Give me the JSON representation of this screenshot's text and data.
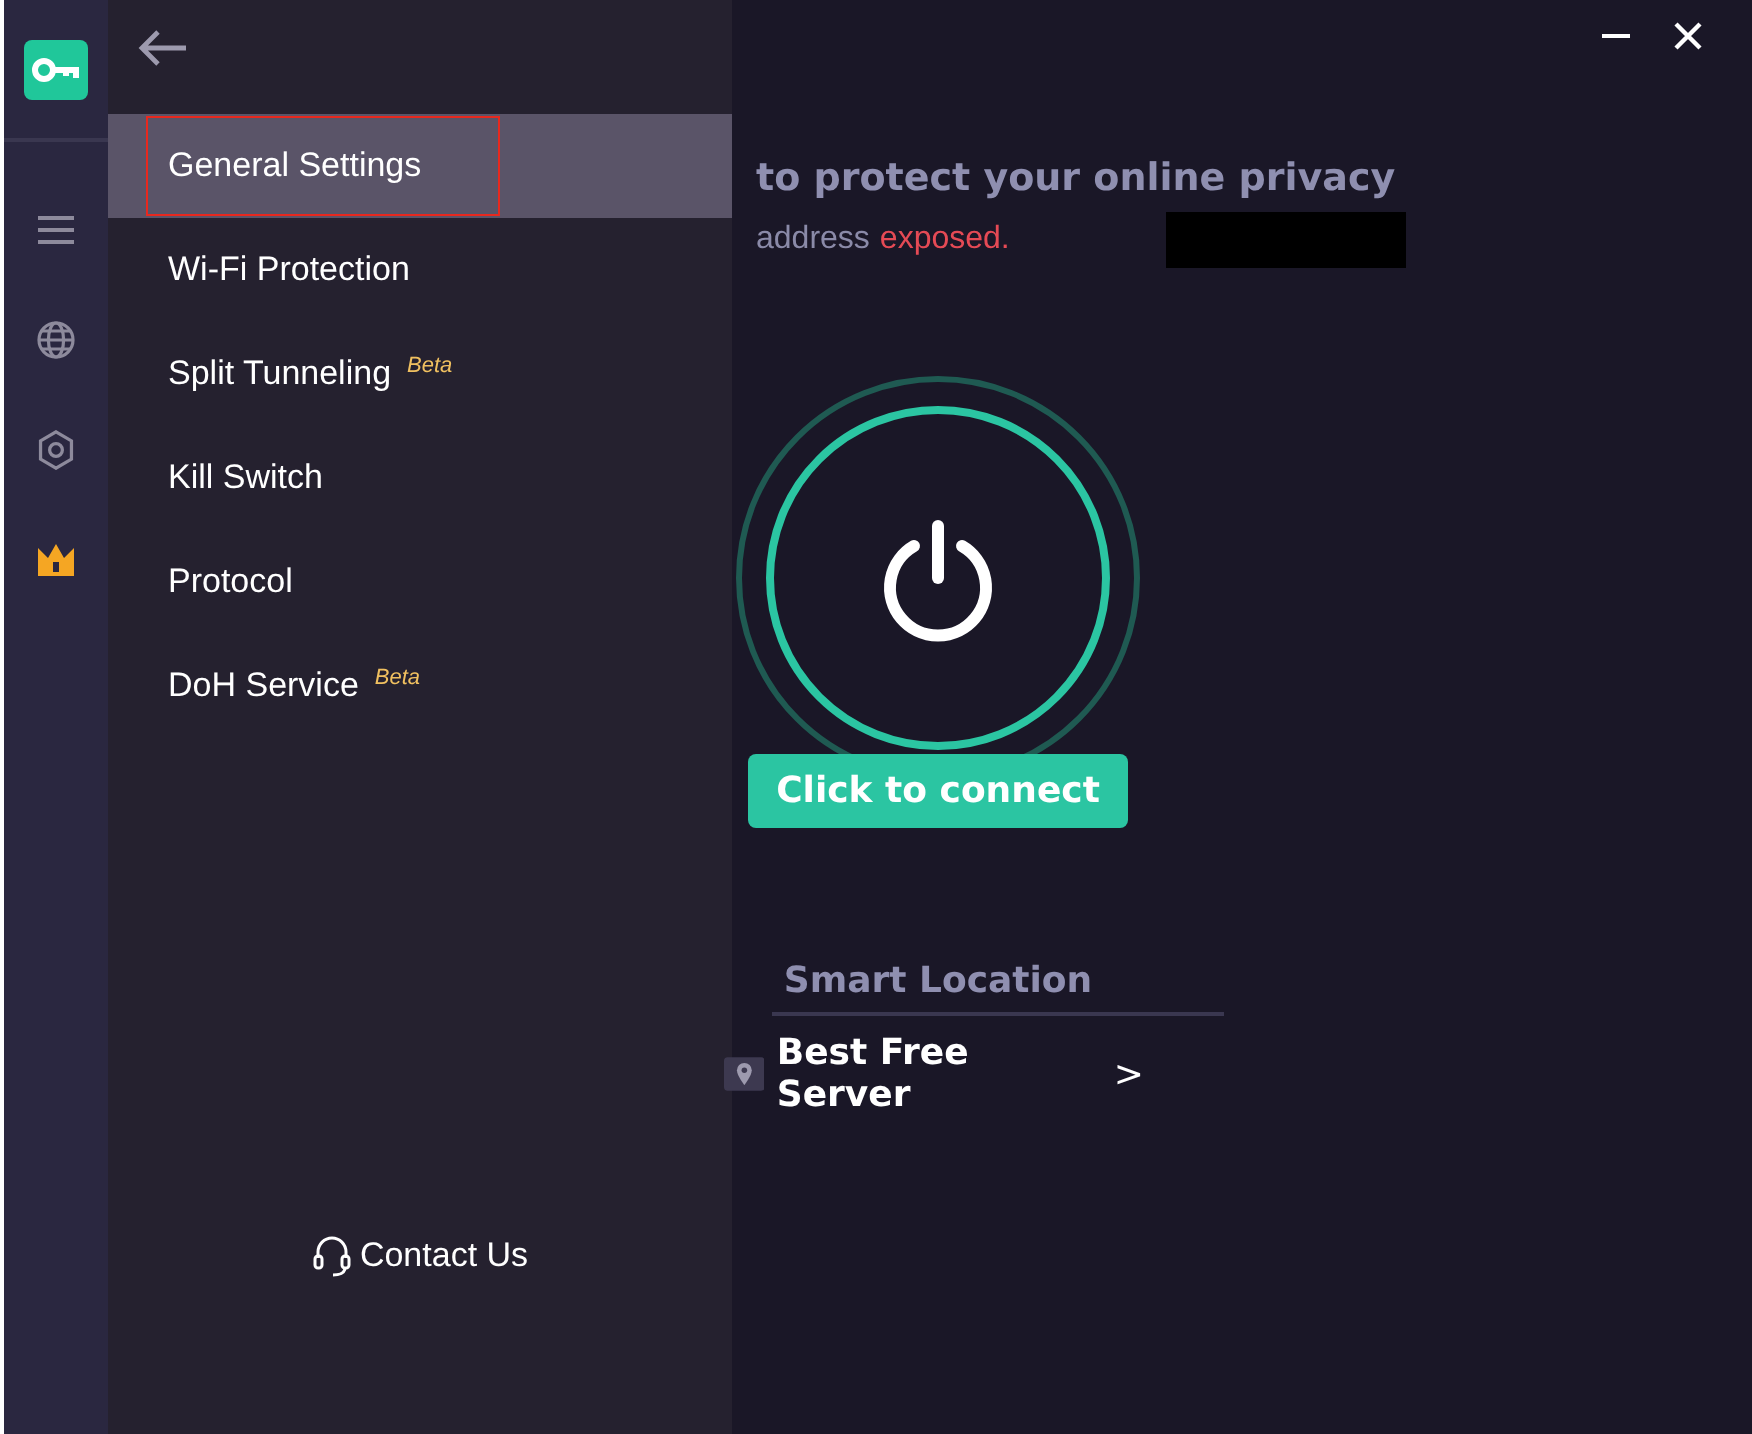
{
  "settings_menu": {
    "items": [
      {
        "label": "General Settings",
        "selected": true
      },
      {
        "label": "Wi-Fi Protection",
        "selected": false
      },
      {
        "label": "Split Tunneling",
        "badge": "Beta",
        "selected": false
      },
      {
        "label": "Kill Switch",
        "selected": false
      },
      {
        "label": "Protocol",
        "selected": false
      },
      {
        "label": "DoH Service",
        "badge": "Beta",
        "selected": false
      }
    ],
    "contact": "Contact Us"
  },
  "main": {
    "heading": "to protect your online privacy",
    "ip_label": "address",
    "ip_status": "exposed.",
    "connect_button": "Click to connect",
    "location_label": "Smart Location",
    "server": "Best Free Server",
    "server_chevron": ">"
  }
}
